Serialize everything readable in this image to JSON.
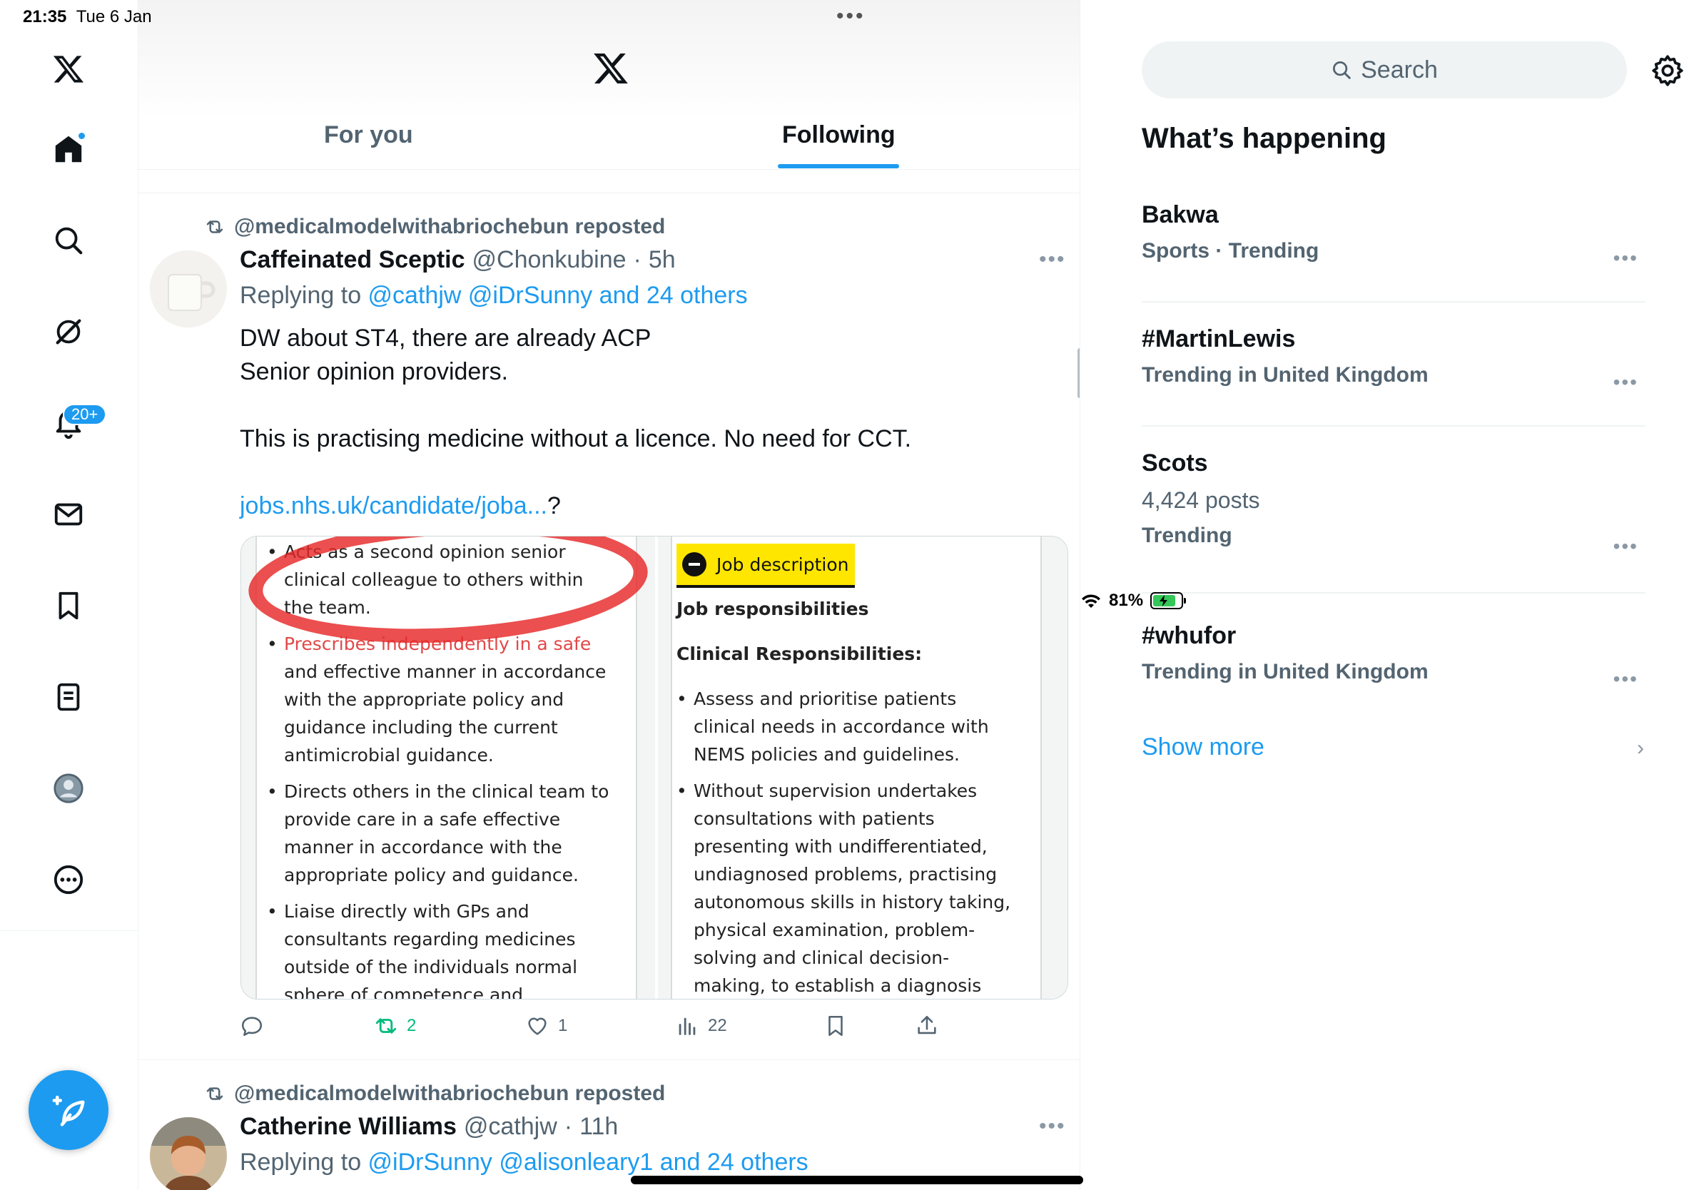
{
  "status_bar": {
    "time": "21:35",
    "date": "Tue 6 Jan",
    "battery": "81%",
    "battery_level": 0.81
  },
  "nav": {
    "items": [
      "x-logo",
      "home-icon",
      "search-icon",
      "grok-icon",
      "notifications-icon",
      "messages-icon",
      "bookmarks-icon",
      "lists-icon",
      "profile-icon",
      "more-icon"
    ],
    "notifications_badge": "20+"
  },
  "header": {
    "tabs": [
      {
        "label": "For you",
        "active": false
      },
      {
        "label": "Following",
        "active": true
      }
    ]
  },
  "posts": [
    {
      "reposted_by": "@medicalmodelwithabriochebun reposted",
      "author": "Caffeinated Sceptic",
      "handle": "@Chonkubine",
      "separator": "·",
      "time": "5h",
      "replying_prefix": "Replying to ",
      "replying_to": "@cathjw @iDrSunny and 24 others",
      "text_lines": [
        "DW about ST4, there are already ACP",
        "Senior opinion providers.",
        "This is practising medicine without a licence. No need for CCT."
      ],
      "link": "jobs.nhs.uk/candidate/joba...",
      "link_suffix": "?",
      "image_left": {
        "bullets": [
          "Acts as a second opinion senior clinical colleague to others within the team.",
          "and effective manner in accordance with the appropriate policy and guidance including the current antimicrobial guidance.",
          "Directs others in the clinical team to provide care in a safe effective manner in accordance with the appropriate policy and guidance.",
          "Liaise directly with GPs and consultants regarding medicines outside of the individuals normal sphere of competence and"
        ],
        "highlight_text": "Prescribes independently in a safe"
      },
      "image_right": {
        "heading": "Job description",
        "sub1": "Job responsibilities",
        "sub2": "Clinical Responsibilities:",
        "bullets": [
          "Assess and prioritise patients clinical needs in accordance with NEMS policies and guidelines.",
          "Without supervision undertakes consultations with patients presenting with undifferentiated, undiagnosed problems, practising autonomous skills in history taking, physical examination, problem-solving and clinical decision-making, to establish a diagnosis and"
        ]
      },
      "stats": {
        "replies": "",
        "reposts": "2",
        "likes": "1",
        "views": "22"
      }
    },
    {
      "reposted_by": "@medicalmodelwithabriochebun reposted",
      "author": "Catherine Williams",
      "handle": "@cathjw",
      "separator": "·",
      "time": "11h",
      "replying_prefix": "Replying to ",
      "replying_to": "@iDrSunny @alisonleary1 and 24 others"
    }
  ],
  "sidebar": {
    "search_placeholder": "Search",
    "title": "What’s happening",
    "trends": [
      {
        "name": "Bakwa",
        "context": "Sports · Trending",
        "count": ""
      },
      {
        "name": "#MartinLewis",
        "context": "Trending in United Kingdom",
        "count": ""
      },
      {
        "name": "Scots",
        "count": "4,424 posts",
        "context": "Trending"
      },
      {
        "name": "#whufor",
        "context": "Trending in United Kingdom",
        "count": ""
      }
    ],
    "show_more": "Show more"
  },
  "colors": {
    "accent": "#1d9bf0",
    "repost_green": "#00ba7c",
    "highlight_yellow": "#ffe600",
    "annotation_red": "#e62828"
  }
}
